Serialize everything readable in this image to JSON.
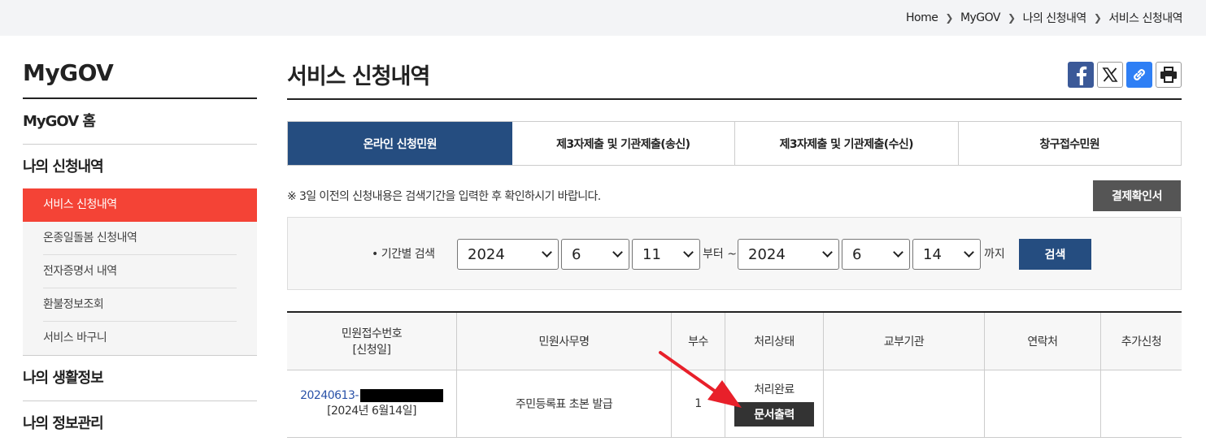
{
  "breadcrumb": [
    "Home",
    "MyGOV",
    "나의 신청내역",
    "서비스 신청내역"
  ],
  "sidebar": {
    "title": "MyGOV",
    "items": [
      {
        "label": "MyGOV 홈"
      },
      {
        "label": "나의 신청내역"
      },
      {
        "label": "나의 생활정보"
      },
      {
        "label": "나의 정보관리"
      }
    ],
    "sub_items": [
      {
        "label": "서비스 신청내역",
        "active": true
      },
      {
        "label": "온종일돌봄 신청내역"
      },
      {
        "label": "전자증명서 내역"
      },
      {
        "label": "환불정보조회"
      },
      {
        "label": "서비스 바구니"
      }
    ]
  },
  "main": {
    "title": "서비스 신청내역",
    "share_icons": [
      "facebook-icon",
      "x-icon",
      "link-icon",
      "print-icon"
    ],
    "tabs": [
      {
        "label": "온라인 신청민원",
        "active": true
      },
      {
        "label": "제3자제출 및 기관제출(송신)"
      },
      {
        "label": "제3자제출 및 기관제출(수신)"
      },
      {
        "label": "창구접수민원"
      }
    ],
    "notice": "※ 3일 이전의 신청내용은 검색기간을 입력한 후 확인하시기 바랍니다.",
    "payment_button": "결제확인서",
    "search": {
      "label": "• 기간별 검색",
      "from_year": "2024",
      "from_month": "6",
      "from_day": "11",
      "from_text": "부터 ~",
      "to_year": "2024",
      "to_month": "6",
      "to_day": "14",
      "to_text": "까지",
      "button": "검색"
    },
    "table": {
      "headers": {
        "receipt_no": "민원접수번호",
        "apply_date": "[신청일]",
        "service_name": "민원사무명",
        "copies": "부수",
        "status": "처리상태",
        "issuing_agency": "교부기관",
        "contact": "연락처",
        "additional": "추가신청"
      },
      "rows": [
        {
          "receipt_no": "20240613-",
          "apply_date": "[2024년 6월14일]",
          "service_name": "주민등록표 초본 발급",
          "copies": "1",
          "status": "처리완료",
          "print_button": "문서출력"
        }
      ]
    }
  },
  "colors": {
    "active_tab": "#254d80",
    "sidebar_active": "#f44336",
    "annotation_arrow": "#e8202a"
  }
}
